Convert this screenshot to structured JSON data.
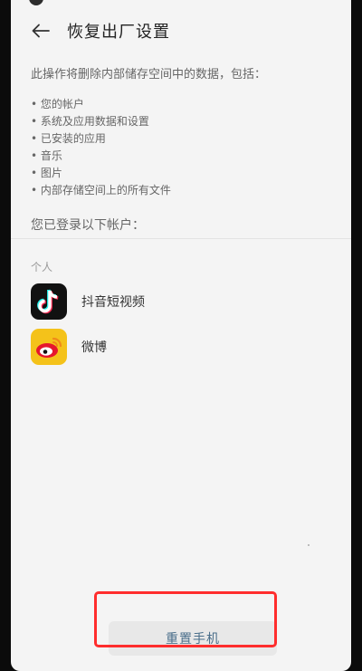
{
  "header": {
    "title": "恢复出厂设置",
    "back_icon": "back-arrow-icon"
  },
  "content": {
    "description": "此操作将删除内部储存空间中的数据，包括：",
    "bullets": [
      "• 您的帐户",
      "• 系统及应用数据和设置",
      "• 已安装的应用",
      "• 音乐",
      "• 图片",
      "• 内部存储空间上的所有文件"
    ],
    "accounts_heading": "您已登录以下帐户："
  },
  "accounts": {
    "section_label": "个人",
    "items": [
      {
        "label": "抖音短视频",
        "icon": "douyin-icon"
      },
      {
        "label": "微博",
        "icon": "weibo-icon"
      }
    ]
  },
  "actions": {
    "reset_label": "重置手机",
    "highlight_color": "#ff2d2d",
    "accent_color": "#4a6e8a"
  }
}
